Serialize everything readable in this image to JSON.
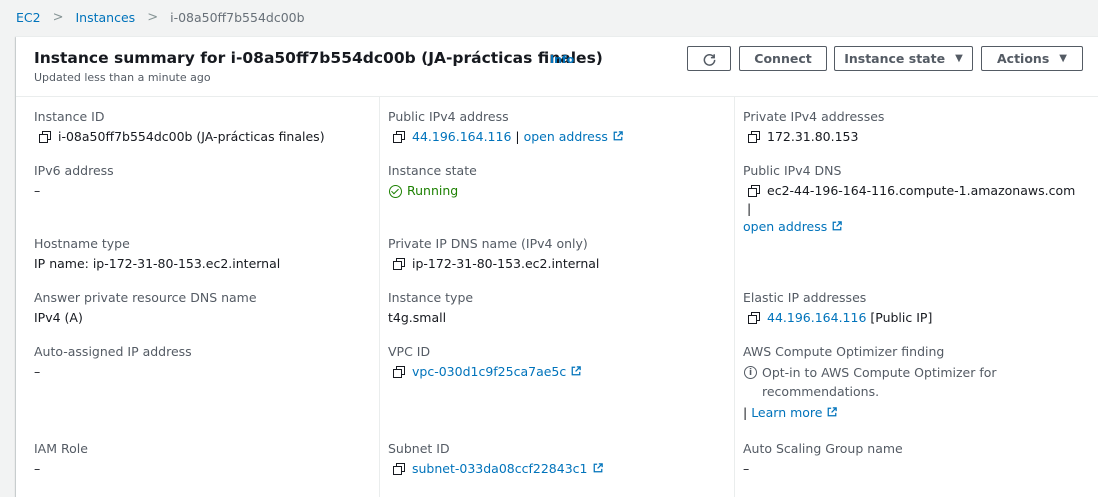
{
  "breadcrumb": {
    "items": [
      "EC2",
      "Instances",
      "i-08a50ff7b554dc00b"
    ],
    "separator": ">"
  },
  "header": {
    "title": "Instance summary for i-08a50ff7b554dc00b (JA-prácticas finales)",
    "info": "Info",
    "updated": "Updated less than a minute ago",
    "buttons": {
      "refresh_icon": "refresh-icon",
      "connect": "Connect",
      "instance_state": "Instance state",
      "actions": "Actions"
    }
  },
  "fields": {
    "instance_id": {
      "label": "Instance ID",
      "value": "i-08a50ff7b554dc00b (JA-prácticas finales)"
    },
    "public_ipv4": {
      "label": "Public IPv4 address",
      "value": "44.196.164.116",
      "sep": " | ",
      "link": "open address"
    },
    "private_ipv4": {
      "label": "Private IPv4 addresses",
      "value": "172.31.80.153"
    },
    "ipv6": {
      "label": "IPv6 address",
      "value": "–"
    },
    "instance_state": {
      "label": "Instance state",
      "value": "Running"
    },
    "public_dns": {
      "label": "Public IPv4 DNS",
      "value": "ec2-44-196-164-116.compute-1.amazonaws.com",
      "sep": " |",
      "link": "open address"
    },
    "hostname_type": {
      "label": "Hostname type",
      "value": "IP name: ip-172-31-80-153.ec2.internal"
    },
    "private_dns": {
      "label": "Private IP DNS name (IPv4 only)",
      "value": "ip-172-31-80-153.ec2.internal"
    },
    "answer_dns": {
      "label": "Answer private resource DNS name",
      "value": "IPv4 (A)"
    },
    "instance_type": {
      "label": "Instance type",
      "value": "t4g.small"
    },
    "elastic_ip": {
      "label": "Elastic IP addresses",
      "value": "44.196.164.116",
      "suffix": " [Public IP]"
    },
    "auto_ip": {
      "label": "Auto-assigned IP address",
      "value": "–"
    },
    "vpc_id": {
      "label": "VPC ID",
      "value": "vpc-030d1c9f25ca7ae5c"
    },
    "optimizer": {
      "label": "AWS Compute Optimizer finding",
      "value": "Opt-in to AWS Compute Optimizer for recommendations.",
      "sep": "| ",
      "link": "Learn more"
    },
    "iam_role": {
      "label": "IAM Role",
      "value": "–"
    },
    "subnet_id": {
      "label": "Subnet ID",
      "value": "subnet-033da08ccf22843c1"
    },
    "asg_name": {
      "label": "Auto Scaling Group name",
      "value": "–"
    }
  },
  "colors": {
    "link": "#0073bb",
    "running": "#1d8102",
    "text": "#16191f",
    "label": "#545b64"
  }
}
